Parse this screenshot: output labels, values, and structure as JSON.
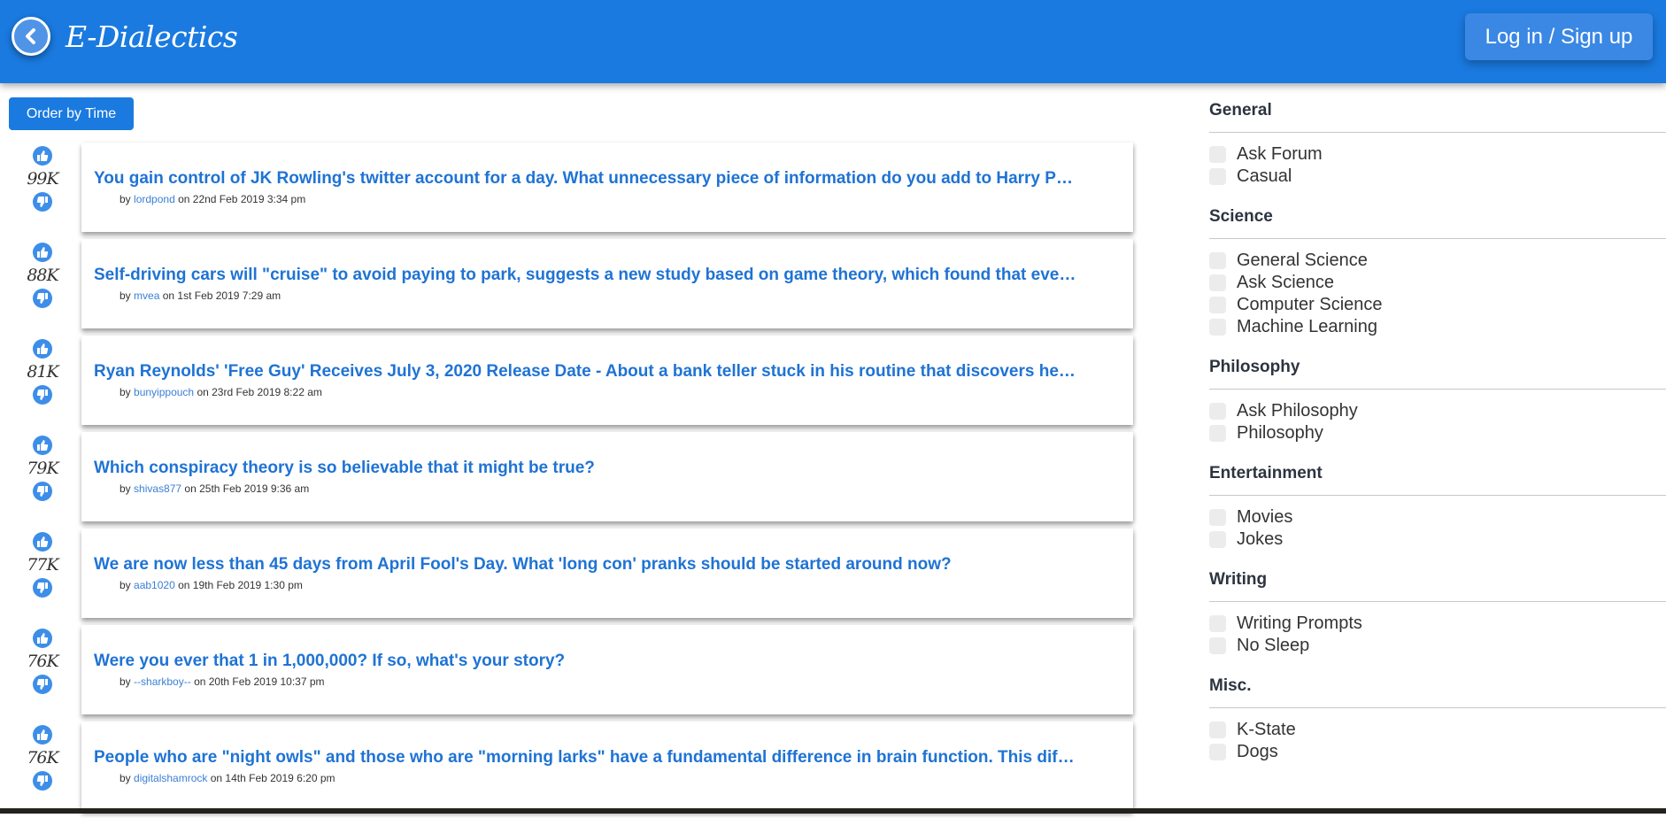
{
  "header": {
    "logo": "E-Dialectics",
    "login_label": "Log in / Sign up"
  },
  "toolbar": {
    "order_label": "Order by Time"
  },
  "posts": [
    {
      "votes": "99K",
      "title": "You gain control of JK Rowling's twitter account for a day. What unnecessary piece of information do you add to Harry Pot…",
      "by": "by",
      "author": "lordpond",
      "on": "on 22nd Feb 2019 3:34 pm"
    },
    {
      "votes": "88K",
      "title": "Self-driving cars will \"cruise\" to avoid paying to park, suggests a new study based on game theory, which found that even…",
      "by": "by",
      "author": "mvea",
      "on": "on 1st Feb 2019 7:29 am"
    },
    {
      "votes": "81K",
      "title": "Ryan Reynolds' 'Free Guy' Receives July 3, 2020 Release Date - About a bank teller stuck in his routine that discovers he'…",
      "by": "by",
      "author": "bunyippouch",
      "on": "on 23rd Feb 2019 8:22 am"
    },
    {
      "votes": "79K",
      "title": "Which conspiracy theory is so believable that it might be true?",
      "by": "by",
      "author": "shivas877",
      "on": "on 25th Feb 2019 9:36 am"
    },
    {
      "votes": "77K",
      "title": "We are now less than 45 days from April Fool's Day. What 'long con' pranks should be started around now?",
      "by": "by",
      "author": "aab1020",
      "on": "on 19th Feb 2019 1:30 pm"
    },
    {
      "votes": "76K",
      "title": "Were you ever that 1 in 1,000,000? If so, what's your story?",
      "by": "by",
      "author": "--sharkboy--",
      "on": "on 20th Feb 2019 10:37 pm"
    },
    {
      "votes": "76K",
      "title": "People who are \"night owls\" and those who are \"morning larks\" have a fundamental difference in brain function. This diffe…",
      "by": "by",
      "author": "digitalshamrock",
      "on": "on 14th Feb 2019 6:20 pm"
    }
  ],
  "sidebar": [
    {
      "heading": "General",
      "items": [
        "Ask Forum",
        "Casual"
      ]
    },
    {
      "heading": "Science",
      "items": [
        "General Science",
        "Ask Science",
        "Computer Science",
        "Machine Learning"
      ]
    },
    {
      "heading": "Philosophy",
      "items": [
        "Ask Philosophy",
        "Philosophy"
      ]
    },
    {
      "heading": "Entertainment",
      "items": [
        "Movies",
        "Jokes"
      ]
    },
    {
      "heading": "Writing",
      "items": [
        "Writing Prompts",
        "No Sleep"
      ]
    },
    {
      "heading": "Misc.",
      "items": [
        "K-State",
        "Dogs"
      ]
    }
  ],
  "colors": {
    "primary": "#1a7ae0",
    "title": "#1f73d4"
  }
}
